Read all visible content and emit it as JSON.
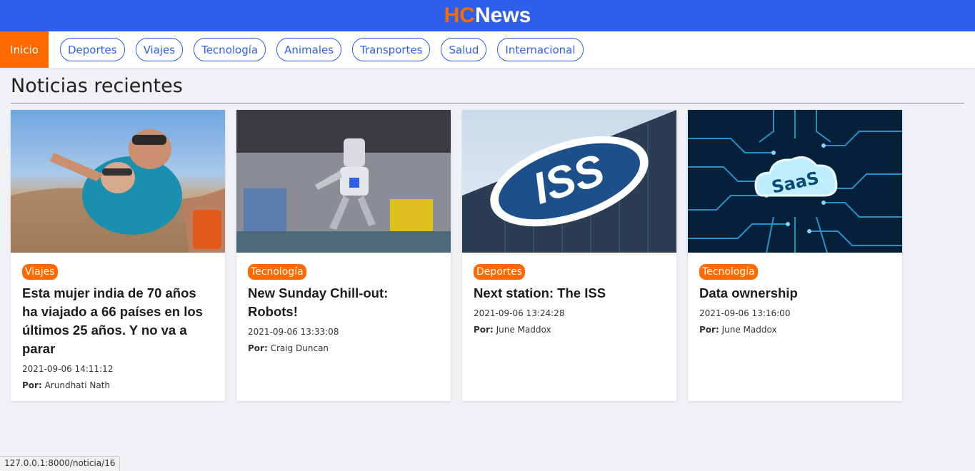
{
  "header": {
    "logo_hc": "HC",
    "logo_news": "News",
    "colors": {
      "brand_blue": "#2f5fe8",
      "accent_orange": "#ff6a00"
    }
  },
  "nav": {
    "home": "Inicio",
    "items": [
      "Deportes",
      "Viajes",
      "Tecnología",
      "Animales",
      "Transportes",
      "Salud",
      "Internacional"
    ]
  },
  "main": {
    "section_title": "Noticias recientes",
    "cards": [
      {
        "image": "skydiving-photo",
        "category": "Viajes",
        "title": "Esta mujer india de 70 años ha viajado a 66 países en los últimos 25 años. Y no va a parar",
        "date": "2021-09-06 14:11:12",
        "author_label": "Por:",
        "author": "Arundhati Nath"
      },
      {
        "image": "robot-photo",
        "category": "Tecnología",
        "title": "New Sunday Chill-out: Robots!",
        "date": "2021-09-06 13:33:08",
        "author_label": "Por:",
        "author": "Craig Duncan"
      },
      {
        "image": "iss-logo-building-photo",
        "category": "Deportes",
        "title": "Next station: The ISS",
        "date": "2021-09-06 13:24:28",
        "author_label": "Por:",
        "author": "June Maddox"
      },
      {
        "image": "saas-circuit-photo",
        "category": "Tecnología",
        "title": "Data ownership",
        "date": "2021-09-06 13:16:00",
        "author_label": "Por:",
        "author": "June Maddox"
      }
    ]
  },
  "status_bar": {
    "url": "127.0.0.1:8000/noticia/16"
  }
}
